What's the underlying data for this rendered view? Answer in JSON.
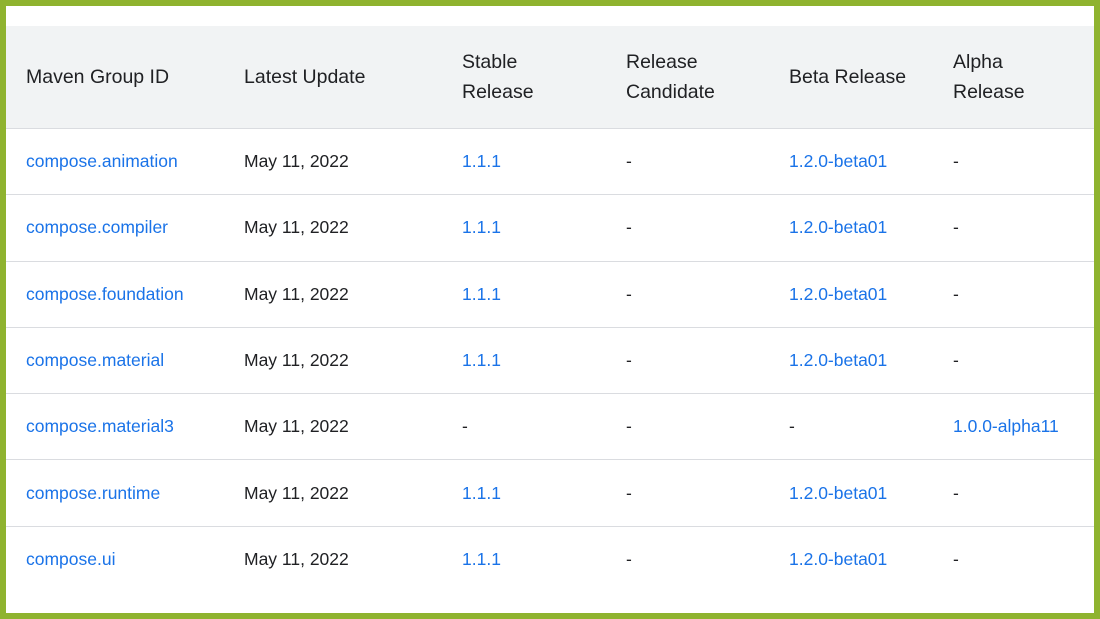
{
  "headers": [
    "Maven Group ID",
    "Latest Update",
    "Stable\nRelease",
    "Release\nCandidate",
    "Beta Release",
    "Alpha\nRelease"
  ],
  "colors": {
    "frame_border": "#8fb32f",
    "header_bg": "#f1f3f4",
    "link": "#1a73e8",
    "text": "#202124",
    "divider": "#dadce0"
  },
  "rows": [
    {
      "group_id": "compose.animation",
      "latest_update": "May 11, 2022",
      "stable": "1.1.1",
      "rc": "-",
      "beta": "1.2.0-beta01",
      "alpha": "-"
    },
    {
      "group_id": "compose.compiler",
      "latest_update": "May 11, 2022",
      "stable": "1.1.1",
      "rc": "-",
      "beta": "1.2.0-beta01",
      "alpha": "-"
    },
    {
      "group_id": "compose.foundation",
      "latest_update": "May 11, 2022",
      "stable": "1.1.1",
      "rc": "-",
      "beta": "1.2.0-beta01",
      "alpha": "-"
    },
    {
      "group_id": "compose.material",
      "latest_update": "May 11, 2022",
      "stable": "1.1.1",
      "rc": "-",
      "beta": "1.2.0-beta01",
      "alpha": "-"
    },
    {
      "group_id": "compose.material3",
      "latest_update": "May 11, 2022",
      "stable": "-",
      "rc": "-",
      "beta": "-",
      "alpha": "1.0.0-alpha11"
    },
    {
      "group_id": "compose.runtime",
      "latest_update": "May 11, 2022",
      "stable": "1.1.1",
      "rc": "-",
      "beta": "1.2.0-beta01",
      "alpha": "-"
    },
    {
      "group_id": "compose.ui",
      "latest_update": "May 11, 2022",
      "stable": "1.1.1",
      "rc": "-",
      "beta": "1.2.0-beta01",
      "alpha": "-"
    }
  ]
}
